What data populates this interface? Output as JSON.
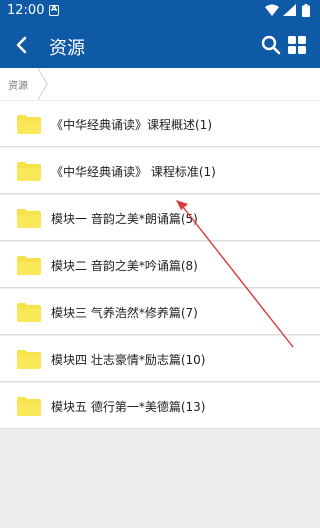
{
  "status": {
    "time": "12:00",
    "notification_letter": "A"
  },
  "appbar": {
    "title": "资源"
  },
  "breadcrumb": {
    "label": "资源"
  },
  "items": [
    {
      "label": "《中华经典诵读》课程概述(1)"
    },
    {
      "label": "《中华经典诵读》 课程标准(1)"
    },
    {
      "label": "模块一 音韵之美*朗诵篇(5)"
    },
    {
      "label": "模块二  音韵之美*吟诵篇(8)"
    },
    {
      "label": "模块三 气养浩然*修养篇(7)"
    },
    {
      "label": "模块四 壮志豪情*励志篇(10)"
    },
    {
      "label": "模块五  德行第一*美德篇(13)"
    }
  ],
  "colors": {
    "appbar": "#0f5aa6",
    "folder": "#f6e24a",
    "annotation_arrow": "#d83a3a"
  }
}
